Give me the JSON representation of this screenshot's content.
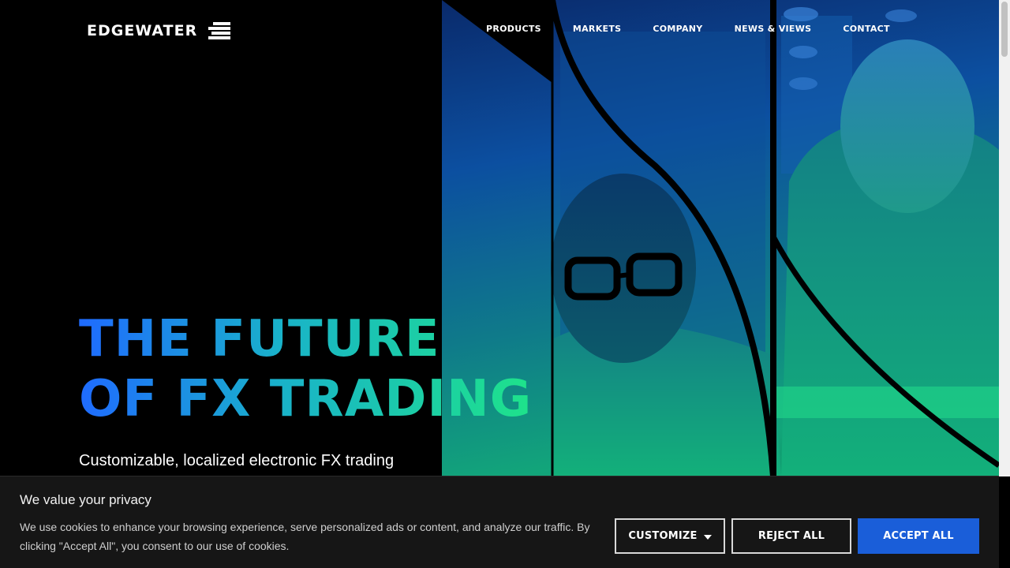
{
  "brand": {
    "name": "EDGEWATER",
    "logo_icon": "edgewater-stripes-icon"
  },
  "nav": {
    "items": [
      {
        "label": "PRODUCTS"
      },
      {
        "label": "MARKETS"
      },
      {
        "label": "COMPANY"
      },
      {
        "label": "NEWS & VIEWS"
      },
      {
        "label": "CONTACT"
      }
    ]
  },
  "hero": {
    "headline_line1": "THE FUTURE",
    "headline_line2": "OF FX TRADING",
    "subheadline": "Customizable, localized electronic FX trading",
    "image_alt": "two-traders-photo",
    "gradient_colors": [
      "#1f6bff",
      "#19b3c9",
      "#1ee38a"
    ]
  },
  "cookie_banner": {
    "title": "We value your privacy",
    "text": "We use cookies to enhance your browsing experience, serve personalized ads or content, and analyze our traffic. By clicking \"Accept All\", you consent to our use of cookies.",
    "customize_label": "CUSTOMIZE",
    "reject_label": "REJECT ALL",
    "accept_label": "ACCEPT ALL",
    "accept_color": "#1a5ed9"
  }
}
